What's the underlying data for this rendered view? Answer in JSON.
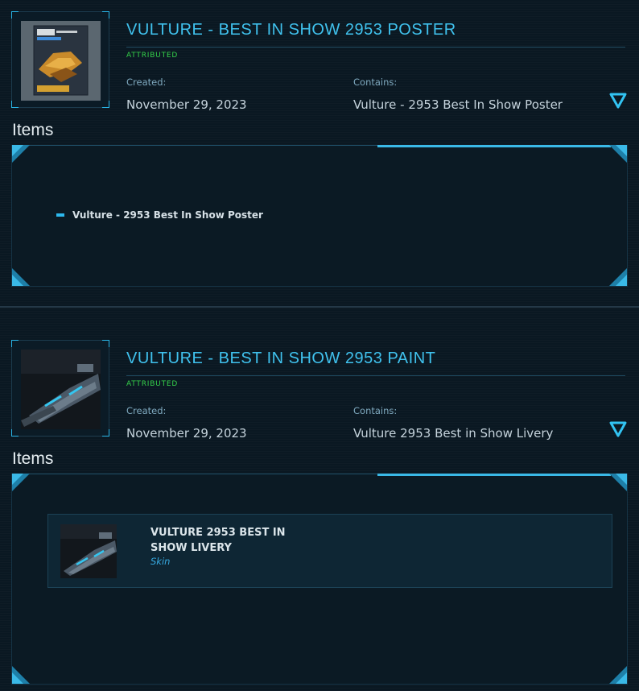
{
  "pledges": [
    {
      "title": "VULTURE - BEST IN SHOW 2953 POSTER",
      "status": "ATTRIBUTED",
      "created_label": "Created:",
      "created_value": "November 29, 2023",
      "contains_label": "Contains:",
      "contains_value": "Vulture - 2953 Best In Show Poster",
      "items_heading": "Items",
      "items": [
        {
          "name": "Vulture - 2953 Best In Show Poster"
        }
      ]
    },
    {
      "title": "VULTURE - BEST IN SHOW 2953 PAINT",
      "status": "ATTRIBUTED",
      "created_label": "Created:",
      "created_value": "November 29, 2023",
      "contains_label": "Contains:",
      "contains_value": "Vulture 2953 Best in Show Livery",
      "items_heading": "Items",
      "items": [
        {
          "name": "VULTURE 2953 BEST IN SHOW LIVERY",
          "type": "Skin"
        }
      ]
    }
  ],
  "colors": {
    "accent": "#40c2ee",
    "status": "#35d24a",
    "background": "#0a1822"
  },
  "icons": {
    "toggle": "chevron-down-triangle-icon",
    "bullet": "bullet-dash-icon"
  }
}
